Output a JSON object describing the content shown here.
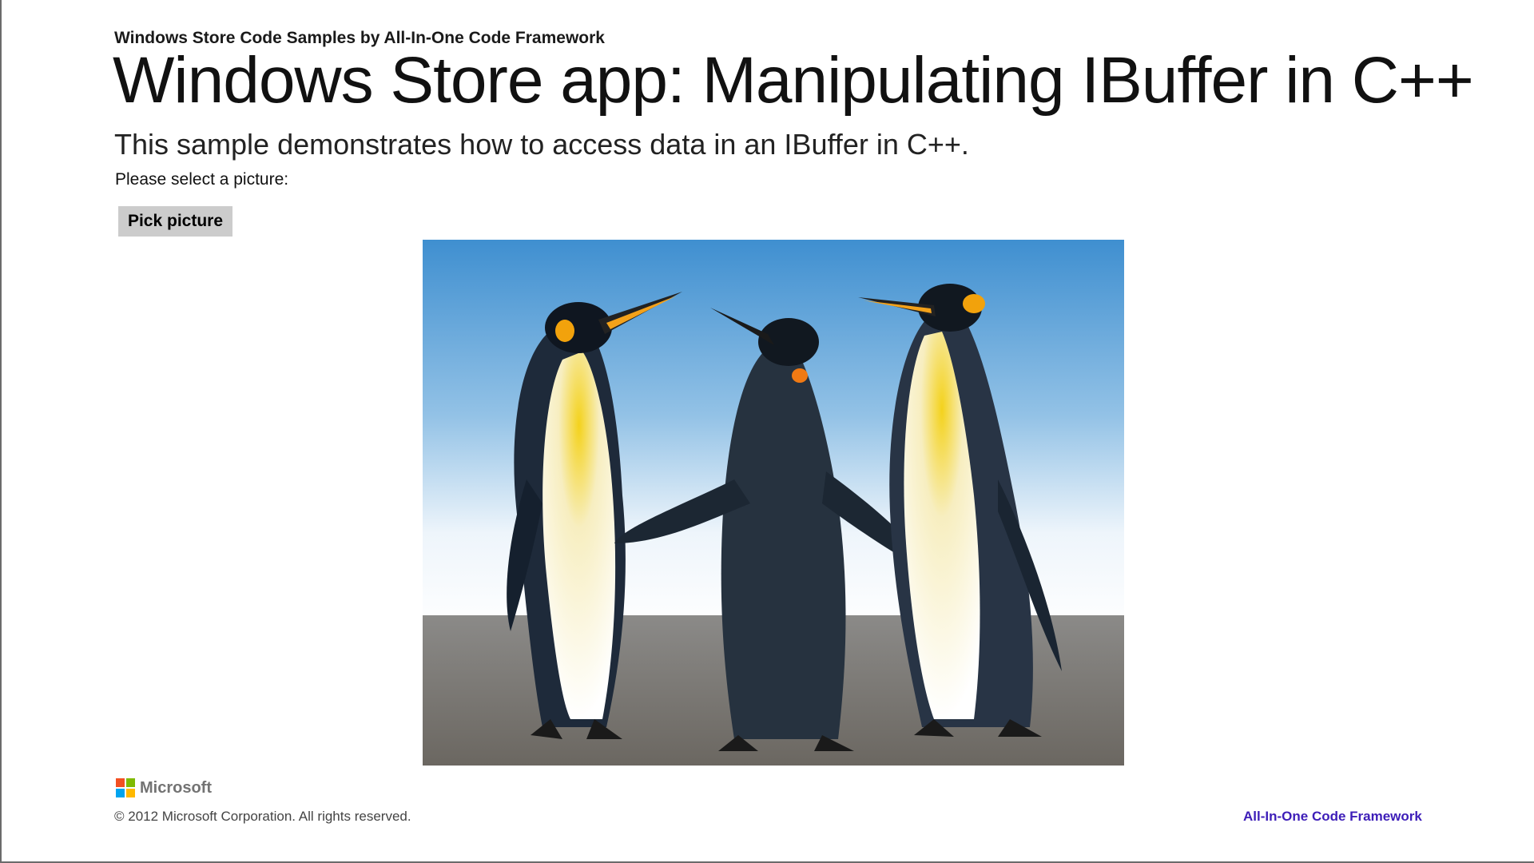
{
  "header": {
    "caption": "Windows Store Code Samples by All-In-One Code Framework",
    "title": "Windows Store app: Manipulating IBuffer in C++",
    "description": "This sample demonstrates how to access data in an IBuffer in C++."
  },
  "main": {
    "prompt_label": "Please select a picture:",
    "pick_button_label": "Pick picture",
    "picture": {
      "subject": "three king penguins on a beach"
    }
  },
  "footer": {
    "brand": "Microsoft",
    "brand_colors": [
      "#f25022",
      "#7fba00",
      "#00a4ef",
      "#ffb900"
    ],
    "copyright": "© 2012 Microsoft Corporation. All rights reserved.",
    "link_label": "All-In-One Code Framework",
    "link_color": "#3d1db8"
  },
  "icons": {
    "logo": "microsoft-logo-icon"
  }
}
